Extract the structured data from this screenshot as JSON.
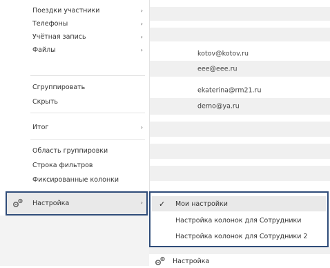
{
  "menu": {
    "items": [
      {
        "label": "Поездки участники",
        "arrow": "›"
      },
      {
        "label": "Телефоны",
        "arrow": "›"
      },
      {
        "label": "Учётная запись",
        "arrow": "›"
      },
      {
        "label": "Файлы",
        "arrow": "›"
      },
      {
        "label": "Сгруппировать"
      },
      {
        "label": "Скрыть"
      },
      {
        "label": "Итог",
        "arrow": "›"
      },
      {
        "label": "Область группировки"
      },
      {
        "label": "Строка фильтров"
      },
      {
        "label": "Фиксированные колонки"
      }
    ],
    "active": {
      "label": "Настройка",
      "arrow": "›",
      "icon": "gears-icon"
    }
  },
  "submenu": {
    "items": [
      {
        "label": "Мои настройки",
        "check": "✓"
      },
      {
        "label": "Настройка колонок для Сотрудники"
      },
      {
        "label": "Настройка колонок для Сотрудники 2"
      }
    ]
  },
  "grid": {
    "emails": [
      "kotov@kotov.ru",
      "eee@eee.ru",
      "ekaterina@rm21.ru",
      "demo@ya.ru"
    ]
  },
  "footer": {
    "label": "Настройка",
    "icon": "gears-icon"
  },
  "colors": {
    "highlight_border": "#2f4c79",
    "stripe": "#f0f0f0",
    "active_bg": "#e9e9e9"
  }
}
